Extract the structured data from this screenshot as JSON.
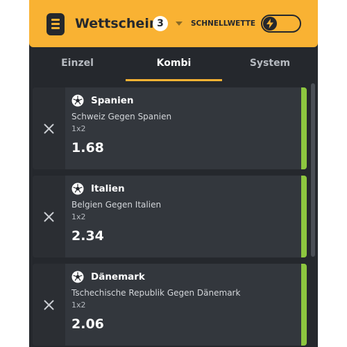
{
  "header": {
    "title": "Wettschein",
    "bet_count": "3",
    "quick_bet_label": "SCHNELLWETTE"
  },
  "tabs": [
    {
      "label": "Einzel",
      "active": false
    },
    {
      "label": "Kombi",
      "active": true
    },
    {
      "label": "System",
      "active": false
    }
  ],
  "bets": [
    {
      "team": "Spanien",
      "match": "Schweiz Gegen Spanien",
      "market": "1x2",
      "odds": "1.68"
    },
    {
      "team": "Italien",
      "match": "Belgien Gegen Italien",
      "market": "1x2",
      "odds": "2.34"
    },
    {
      "team": "Dänemark",
      "match": "Tschechische Republik Gegen Dänemark",
      "market": "1x2",
      "odds": "2.06"
    }
  ],
  "colors": {
    "accent": "#f9b233",
    "panel": "#25282d",
    "card": "#33373d",
    "selection_indicator": "#8dc63f"
  },
  "icons": {
    "menu": "menu-icon",
    "dropdown": "caret-down-icon",
    "quick_bet": "lightning-icon",
    "sport": "soccer-ball-icon",
    "remove": "close-icon"
  }
}
